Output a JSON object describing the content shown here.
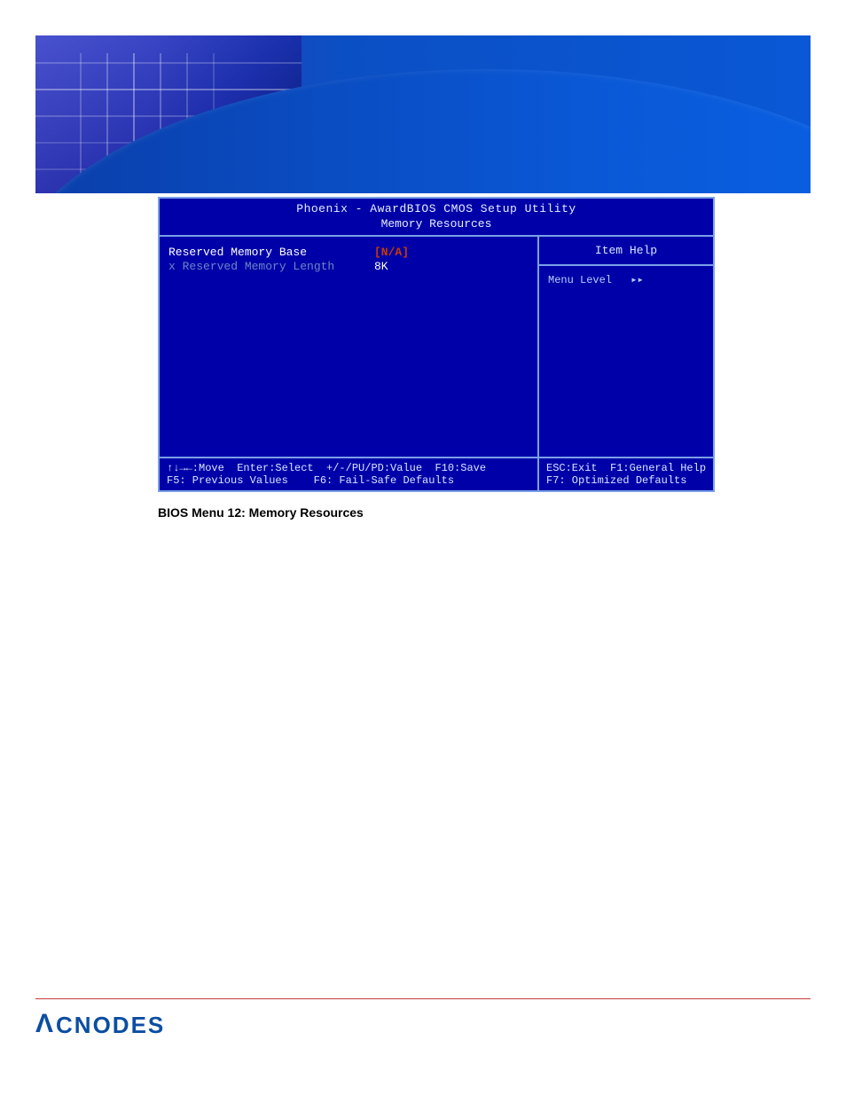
{
  "banner": {
    "alt": "decorative blue circuit banner"
  },
  "bios": {
    "title": "Phoenix - AwardBIOS CMOS Setup Utility",
    "subtitle": "Memory Resources",
    "left_items": [
      {
        "label": "Reserved Memory Base",
        "value": "[N/A]",
        "selected": true,
        "disabled": false
      },
      {
        "label": "Reserved Memory Length",
        "value": "8K",
        "selected": false,
        "disabled": true
      }
    ],
    "right": {
      "heading": "Item Help",
      "menu_level_label": "Menu Level",
      "menu_level_arrows": "▸▸"
    },
    "footer_left_line1": "↑↓→←:Move  Enter:Select  +/-/PU/PD:Value  F10:Save",
    "footer_left_line2": "F5: Previous Values    F6: Fail-Safe Defaults",
    "footer_right_line1": "ESC:Exit  F1:General Help",
    "footer_right_line2": "F7: Optimized Defaults"
  },
  "caption": "BIOS Menu 12: Memory Resources",
  "footer": {
    "brand_lambda": "Λ",
    "brand_rest": "CNODES"
  }
}
